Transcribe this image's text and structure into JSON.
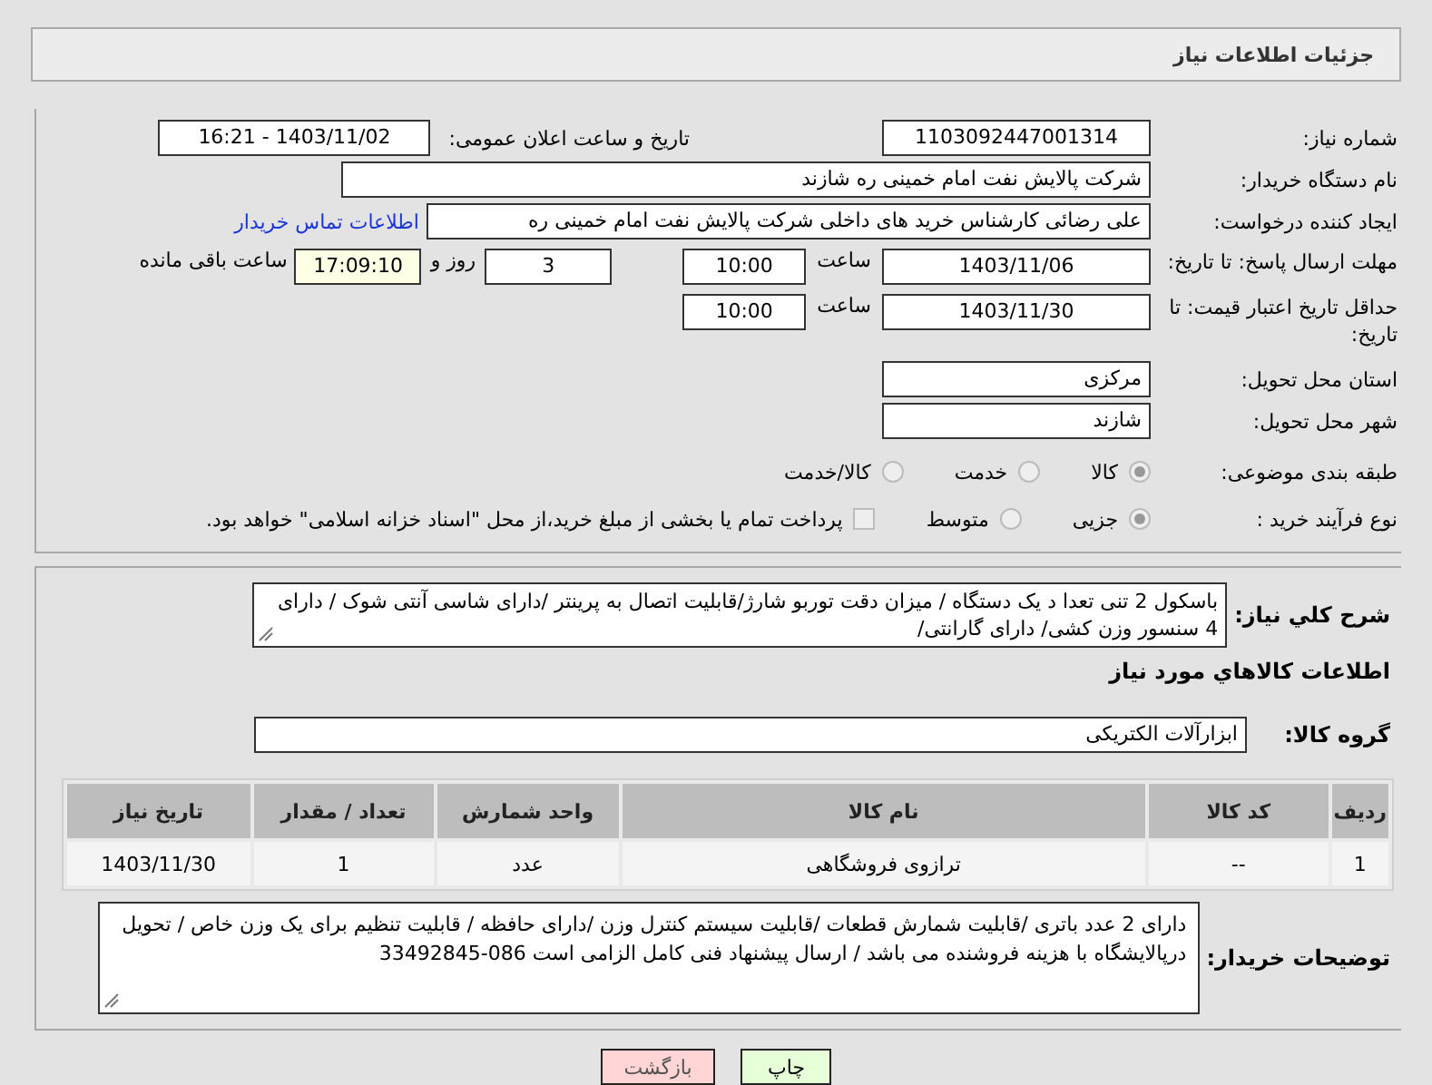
{
  "header": {
    "title": "جزئیات اطلاعات نیاز"
  },
  "need_number": {
    "label": "شماره نیاز:",
    "value": "1103092447001314"
  },
  "announce": {
    "label": "تاریخ و ساعت اعلان عمومی:",
    "value": "1403/11/02 - 16:21"
  },
  "buyer_org": {
    "label": "نام دستگاه خریدار:",
    "value": "شرکت پالایش نفت امام خمینی  ره  شازند"
  },
  "requester": {
    "label": "ایجاد کننده درخواست:",
    "value": "علی  رضائی کارشناس خرید های داخلی  شرکت پالایش نفت امام خمینی  ره",
    "contact_link": "اطلاعات تماس خریدار"
  },
  "reply_deadline": {
    "label": "مهلت ارسال پاسخ: تا تاریخ:",
    "date": "1403/11/06",
    "time_label": "ساعت",
    "time": "10:00",
    "days": "3",
    "days_label": "روز و",
    "remaining": "17:09:10",
    "remaining_label": "ساعت باقی مانده"
  },
  "price_validity": {
    "label": "حداقل تاریخ اعتبار قیمت: تا تاریخ:",
    "date": "1403/11/30",
    "time_label": "ساعت",
    "time": "10:00"
  },
  "province": {
    "label": "استان محل تحویل:",
    "value": "مرکزی"
  },
  "city": {
    "label": "شهر محل تحویل:",
    "value": "شازند"
  },
  "category": {
    "label": "طبقه بندی موضوعی:",
    "options": [
      {
        "label": "کالا",
        "selected": true
      },
      {
        "label": "خدمت",
        "selected": false
      },
      {
        "label": "کالا/خدمت",
        "selected": false
      }
    ]
  },
  "purchase_process": {
    "label": "نوع فرآیند خرید :",
    "options": [
      {
        "label": "جزیی",
        "selected": true
      },
      {
        "label": "متوسط",
        "selected": false
      }
    ],
    "payment_checkbox": {
      "label": "پرداخت تمام یا بخشی از مبلغ خرید،از محل \"اسناد خزانه اسلامی\" خواهد بود.",
      "checked": false
    }
  },
  "description": {
    "label": "شرح کلي نياز:",
    "value": "باسکول 2 تنی  تعدا د یک دستگاه / میزان دقت توربو شارژ/قابلیت اتصال به پرینتر /دارای شاسی آنتی شوک / دارای 4 سنسور وزن کشی/ دارای گارانتی/"
  },
  "items_heading": "اطلاعات کالاهاي مورد نياز",
  "goods_group": {
    "label": "گروه کالا:",
    "value": "ابزارآلات الکتریکی"
  },
  "items_table": {
    "columns": [
      "ردیف",
      "کد کالا",
      "نام کالا",
      "واحد شمارش",
      "تعداد / مقدار",
      "تاریخ نیاز"
    ],
    "rows": [
      [
        "1",
        "--",
        "ترازوی فروشگاهی",
        "عدد",
        "1",
        "1403/11/30"
      ]
    ]
  },
  "buyer_notes": {
    "label": "توضیحات خریدار:",
    "value": "دارای 2 عدد باتری /قابلیت شمارش قطعات /قابلیت سیستم کنترل وزن /دارای حافظه / قابلیت تنظیم برای یک وزن خاص / تحویل درپالایشگاه با هزینه فروشنده می باشد / ارسال پیشنهاد فنی کامل الزامی است   086-33492845"
  },
  "buttons": [
    {
      "label": "چاپ",
      "kind": "print"
    },
    {
      "label": "بازگشت",
      "kind": "back"
    }
  ]
}
